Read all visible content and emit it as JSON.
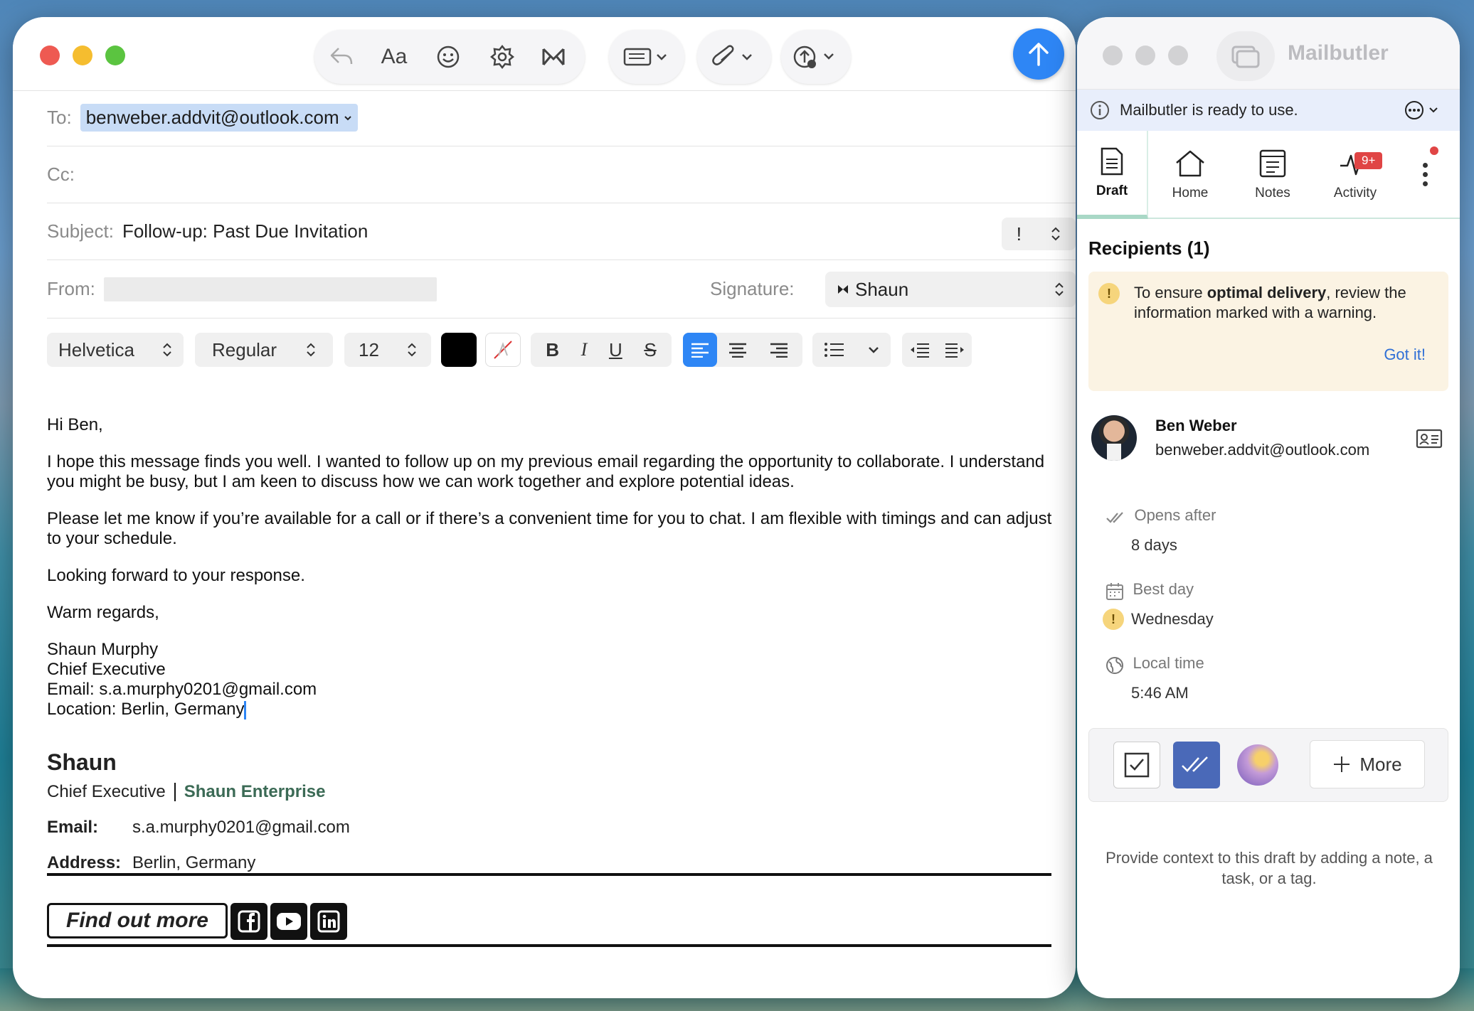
{
  "compose": {
    "to_label": "To:",
    "to_value": "benweber.addvit@outlook.com",
    "cc_label": "Cc:",
    "subject_label": "Subject:",
    "subject_value": "Follow-up: Past Due Invitation",
    "priority_value": "!",
    "from_label": "From:",
    "signature_label": "Signature:",
    "signature_value": "Shaun",
    "format": {
      "font": "Helvetica",
      "style": "Regular",
      "size": "12",
      "text_color": "#000000"
    },
    "toolbar_icons": [
      "reply-icon",
      "font-icon",
      "emoji-icon",
      "photo-browser-icon",
      "mailbutler-icon",
      "markup-icon",
      "attachment-icon",
      "attach-upload-icon",
      "send-icon"
    ],
    "body": {
      "greeting": "Hi Ben,",
      "p1": "I hope this message finds you well. I wanted to follow up on my previous email regarding the opportunity to collaborate. I understand you might be busy, but I am keen to discuss how we can work together and explore potential ideas.",
      "p2": "Please let me know if you’re available for a call or if there’s a convenient time for you to chat. I am flexible with timings and can adjust to your schedule.",
      "p3": "Looking forward to your response.",
      "closing": "Warm regards,",
      "sig_lines": [
        "Shaun Murphy",
        "Chief Executive",
        "Email: s.a.murphy0201@gmail.com",
        "Location: Berlin, Germany"
      ]
    },
    "signature_block": {
      "name": "Shaun",
      "role": "Chief Executive",
      "company": "Shaun Enterprise",
      "email_label": "Email:",
      "email_value": "s.a.murphy0201@gmail.com",
      "address_label": "Address:",
      "address_value": "Berlin, Germany",
      "cta": "Find out more",
      "social": [
        "facebook-icon",
        "youtube-icon",
        "linkedin-icon"
      ]
    }
  },
  "mailbutler": {
    "title": "Mailbutler",
    "banner": "Mailbutler is ready to use.",
    "tabs": [
      {
        "label": "Draft",
        "active": true
      },
      {
        "label": "Home"
      },
      {
        "label": "Notes"
      },
      {
        "label": "Activity",
        "badge": "9+"
      }
    ],
    "recipients_title": "Recipients (1)",
    "warning": {
      "pre": "To ensure ",
      "bold": "optimal delivery",
      "post": ", review the information marked with a warning.",
      "action": "Got it!"
    },
    "contact": {
      "name": "Ben Weber",
      "email": "benweber.addvit@outlook.com"
    },
    "opens_label": "Opens after",
    "opens_value": "8 days",
    "best_day_label": "Best day",
    "best_day_value": "Wednesday",
    "local_time_label": "Local time",
    "local_time_value": "5:46 AM",
    "more_label": "More",
    "footer_hint": "Provide context to this draft by adding a note, a task, or a tag.",
    "colors": {
      "accent": "#2e86f5",
      "tracking": "#4a69b8",
      "warning": "#f2c94c",
      "badge": "#e04545"
    }
  }
}
